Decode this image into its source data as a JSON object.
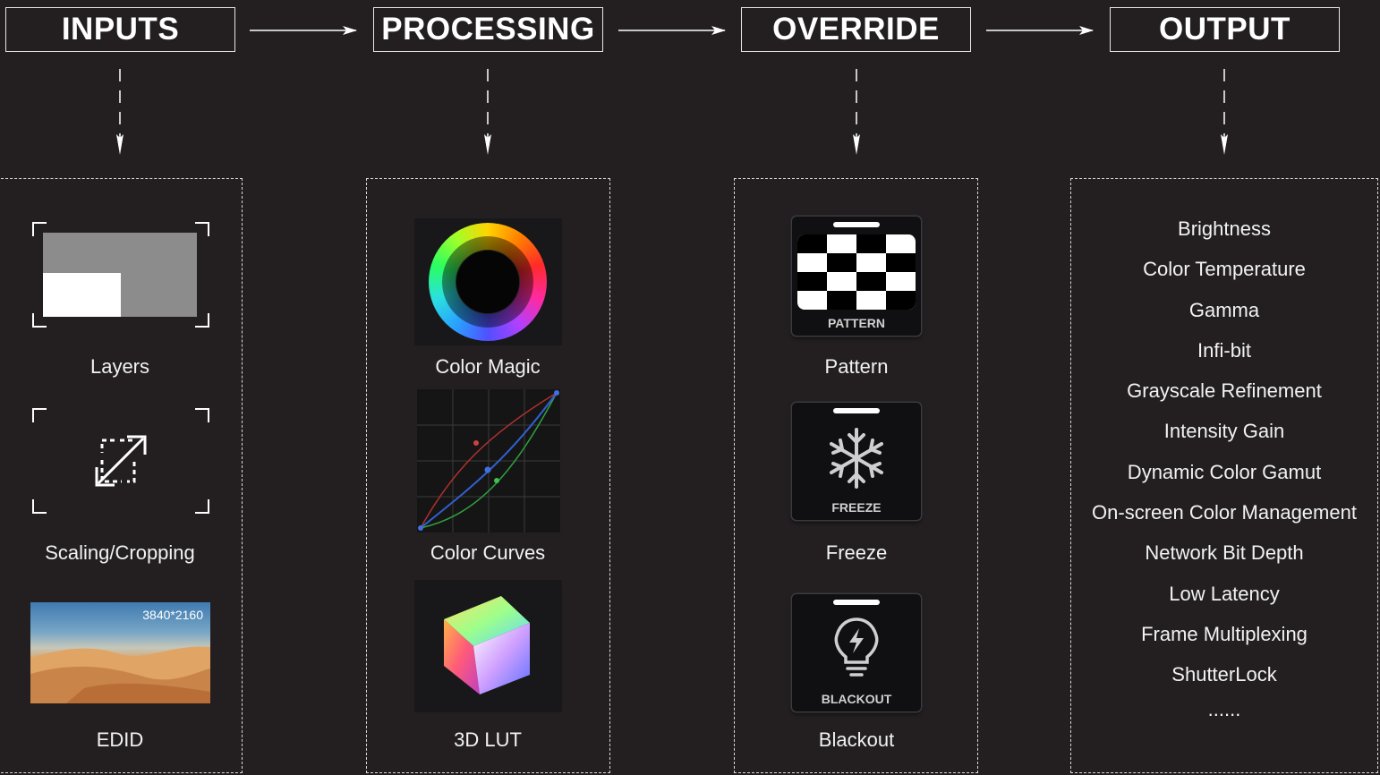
{
  "stages": [
    {
      "title": "INPUTS"
    },
    {
      "title": "PROCESSING"
    },
    {
      "title": "OVERRIDE"
    },
    {
      "title": "OUTPUT"
    }
  ],
  "inputs": {
    "layers_label": "Layers",
    "scaling_label": "Scaling/Cropping",
    "edid_label": "EDID",
    "edid_resolution": "3840*2160"
  },
  "processing": {
    "color_magic_label": "Color Magic",
    "color_curves_label": "Color Curves",
    "lut_label": "3D LUT"
  },
  "override": {
    "pattern_label": "Pattern",
    "pattern_caption": "PATTERN",
    "freeze_label": "Freeze",
    "freeze_caption": "FREEZE",
    "blackout_label": "Blackout",
    "blackout_caption": "BLACKOUT"
  },
  "output": {
    "items": [
      "Brightness",
      "Color Temperature",
      "Gamma",
      "Infi-bit",
      "Grayscale Refinement",
      "Intensity Gain",
      "Dynamic Color Gamut",
      "On-screen Color Management",
      "Network Bit Depth",
      "Low Latency",
      "Frame Multiplexing",
      "ShutterLock",
      "......"
    ]
  },
  "colors": {
    "background": "#231f20",
    "border": "#e6e6e6",
    "text": "#ffffff"
  }
}
